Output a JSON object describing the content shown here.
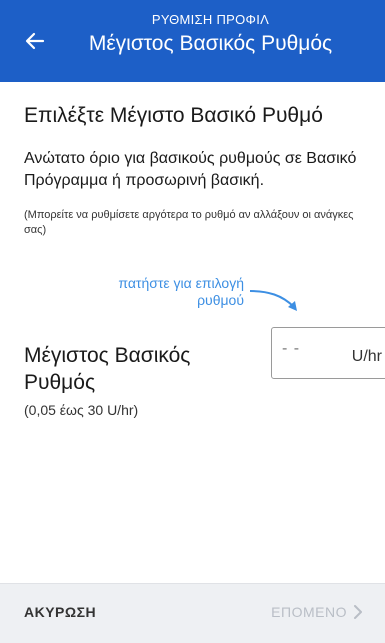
{
  "header": {
    "kicker": "ΡΥΘΜΙΣΗ ΠΡΟΦΙΛ",
    "title": "Μέγιστος Βασικός Ρυθμός",
    "back_icon": "arrow-left-icon"
  },
  "main": {
    "heading": "Επιλέξτε Μέγιστο Βασικό Ρυθμό",
    "description": "Ανώτατο όριο για βασικούς ρυθμούς σε Βασικό Πρόγραμμα ή προσωρινή βασική.",
    "note": "(Μπορείτε να ρυθμίσετε αργότερα το ρυθμό αν αλλάξουν οι ανάγκες σας)",
    "hint_line1": "πατήστε για επιλογή",
    "hint_line2": "ρυθμού",
    "field_label": "Μέγιστος Βασικός Ρυθμός",
    "range": "(0,05 έως 30 U/hr)",
    "input_value": "- -",
    "input_unit": "U/hr"
  },
  "footer": {
    "cancel_label": "ΑΚΥΡΩΣΗ",
    "next_label": "ΕΠΟΜΕΝΟ",
    "next_icon": "chevron-right-icon"
  },
  "colors": {
    "header_bg": "#1d5fc7",
    "hint": "#3d8fe3",
    "footer_bg": "#eef0f3",
    "disabled": "#b9bec6"
  }
}
